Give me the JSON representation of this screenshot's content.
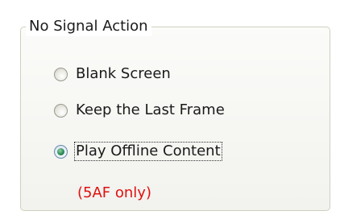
{
  "group": {
    "title": "No Signal Action"
  },
  "options": [
    {
      "label": "Blank Screen",
      "selected": false
    },
    {
      "label": "Keep the Last Frame",
      "selected": false
    },
    {
      "label": "Play Offline Content",
      "selected": true
    }
  ],
  "note": "(5AF only)",
  "colors": {
    "note_text": "#e01010",
    "group_border": "#d0d0bf",
    "radio_selected_dot": "#2f8c5a"
  }
}
